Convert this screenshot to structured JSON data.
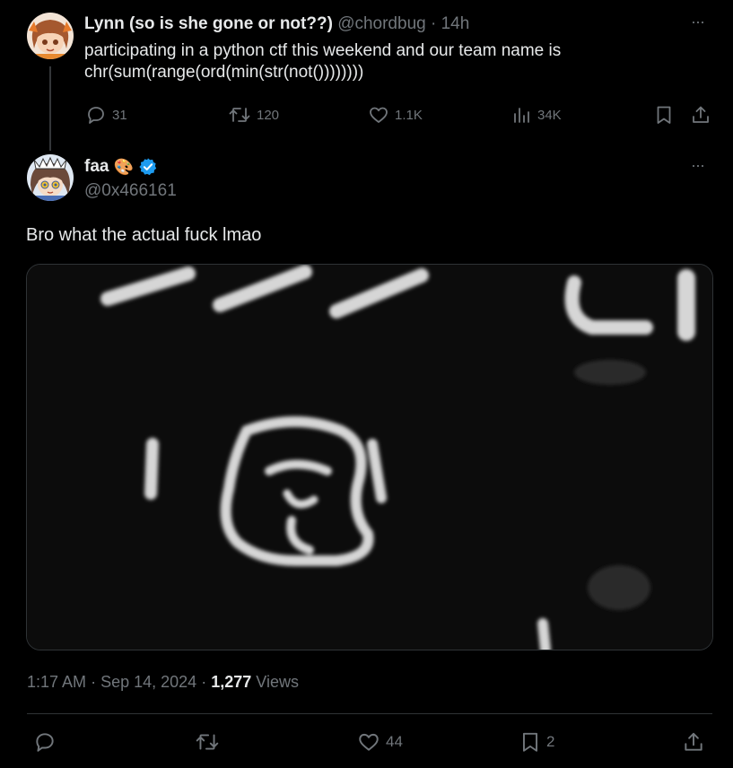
{
  "parent_tweet": {
    "display_name": "Lynn (so is she gone or not??)",
    "handle": "@chordbug",
    "separator": "·",
    "time": "14h",
    "text_line1": "participating in a python ctf this weekend and our team name is",
    "text_line2": "chr(sum(range(ord(min(str(not())))))))",
    "replies": "31",
    "reposts": "120",
    "likes": "1.1K",
    "views": "34K",
    "more": "···"
  },
  "main_tweet": {
    "display_name": "faa",
    "emoji": "🎨",
    "handle": "@0x466161",
    "more": "···",
    "text": "Bro what the actual fuck lmao",
    "time": "1:17 AM",
    "dot1": "·",
    "date": "Sep 14, 2024",
    "dot2": "·",
    "view_count": "1,277",
    "views_label": "Views",
    "likes": "44",
    "bookmarks": "2"
  },
  "colors": {
    "background": "#000000",
    "text": "#e7e9ea",
    "muted": "#71767b",
    "verified": "#1d9bf0",
    "border": "#2f3336"
  },
  "icons": {
    "reply": "reply-icon",
    "repost": "repost-icon",
    "like": "heart-icon",
    "views": "views-icon",
    "bookmark": "bookmark-icon",
    "share": "share-icon",
    "more": "more-icon",
    "verified": "verified-badge-icon"
  }
}
